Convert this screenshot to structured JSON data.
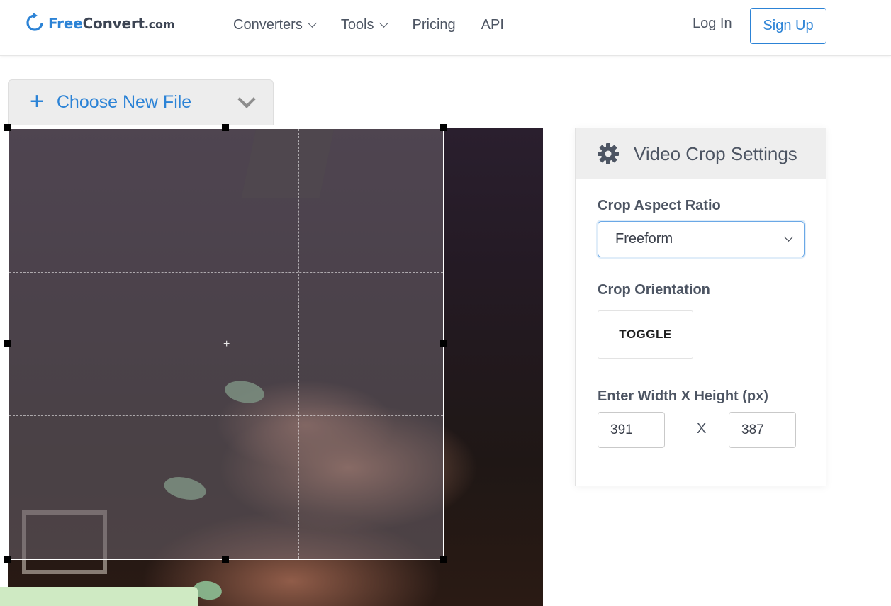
{
  "header": {
    "logo": {
      "free": "Free",
      "convert": "Convert",
      "com": ".com"
    },
    "nav": [
      {
        "label": "Converters",
        "has_dropdown": true
      },
      {
        "label": "Tools",
        "has_dropdown": true
      },
      {
        "label": "Pricing",
        "has_dropdown": false
      },
      {
        "label": "API",
        "has_dropdown": false
      }
    ],
    "login_label": "Log In",
    "signup_label": "Sign Up"
  },
  "file_picker": {
    "plus_icon": "+",
    "choose_label": "Choose New File",
    "dropdown_icon": "chevron-down-icon"
  },
  "crop_editor": {
    "center_marker": "+"
  },
  "settings": {
    "title": "Video Crop Settings",
    "icon": "gear-icon",
    "aspect_ratio_label": "Crop Aspect Ratio",
    "aspect_ratio_value": "Freeform",
    "orientation_label": "Crop Orientation",
    "toggle_label": "TOGGLE",
    "dimensions_label": "Enter Width X Height (px)",
    "width_value": "391",
    "separator": "X",
    "height_value": "387"
  },
  "colors": {
    "accent": "#2c83d6",
    "text": "#4d5563",
    "panel_header_bg": "#eeeeee",
    "bottom_bar": "#cfeac3"
  }
}
